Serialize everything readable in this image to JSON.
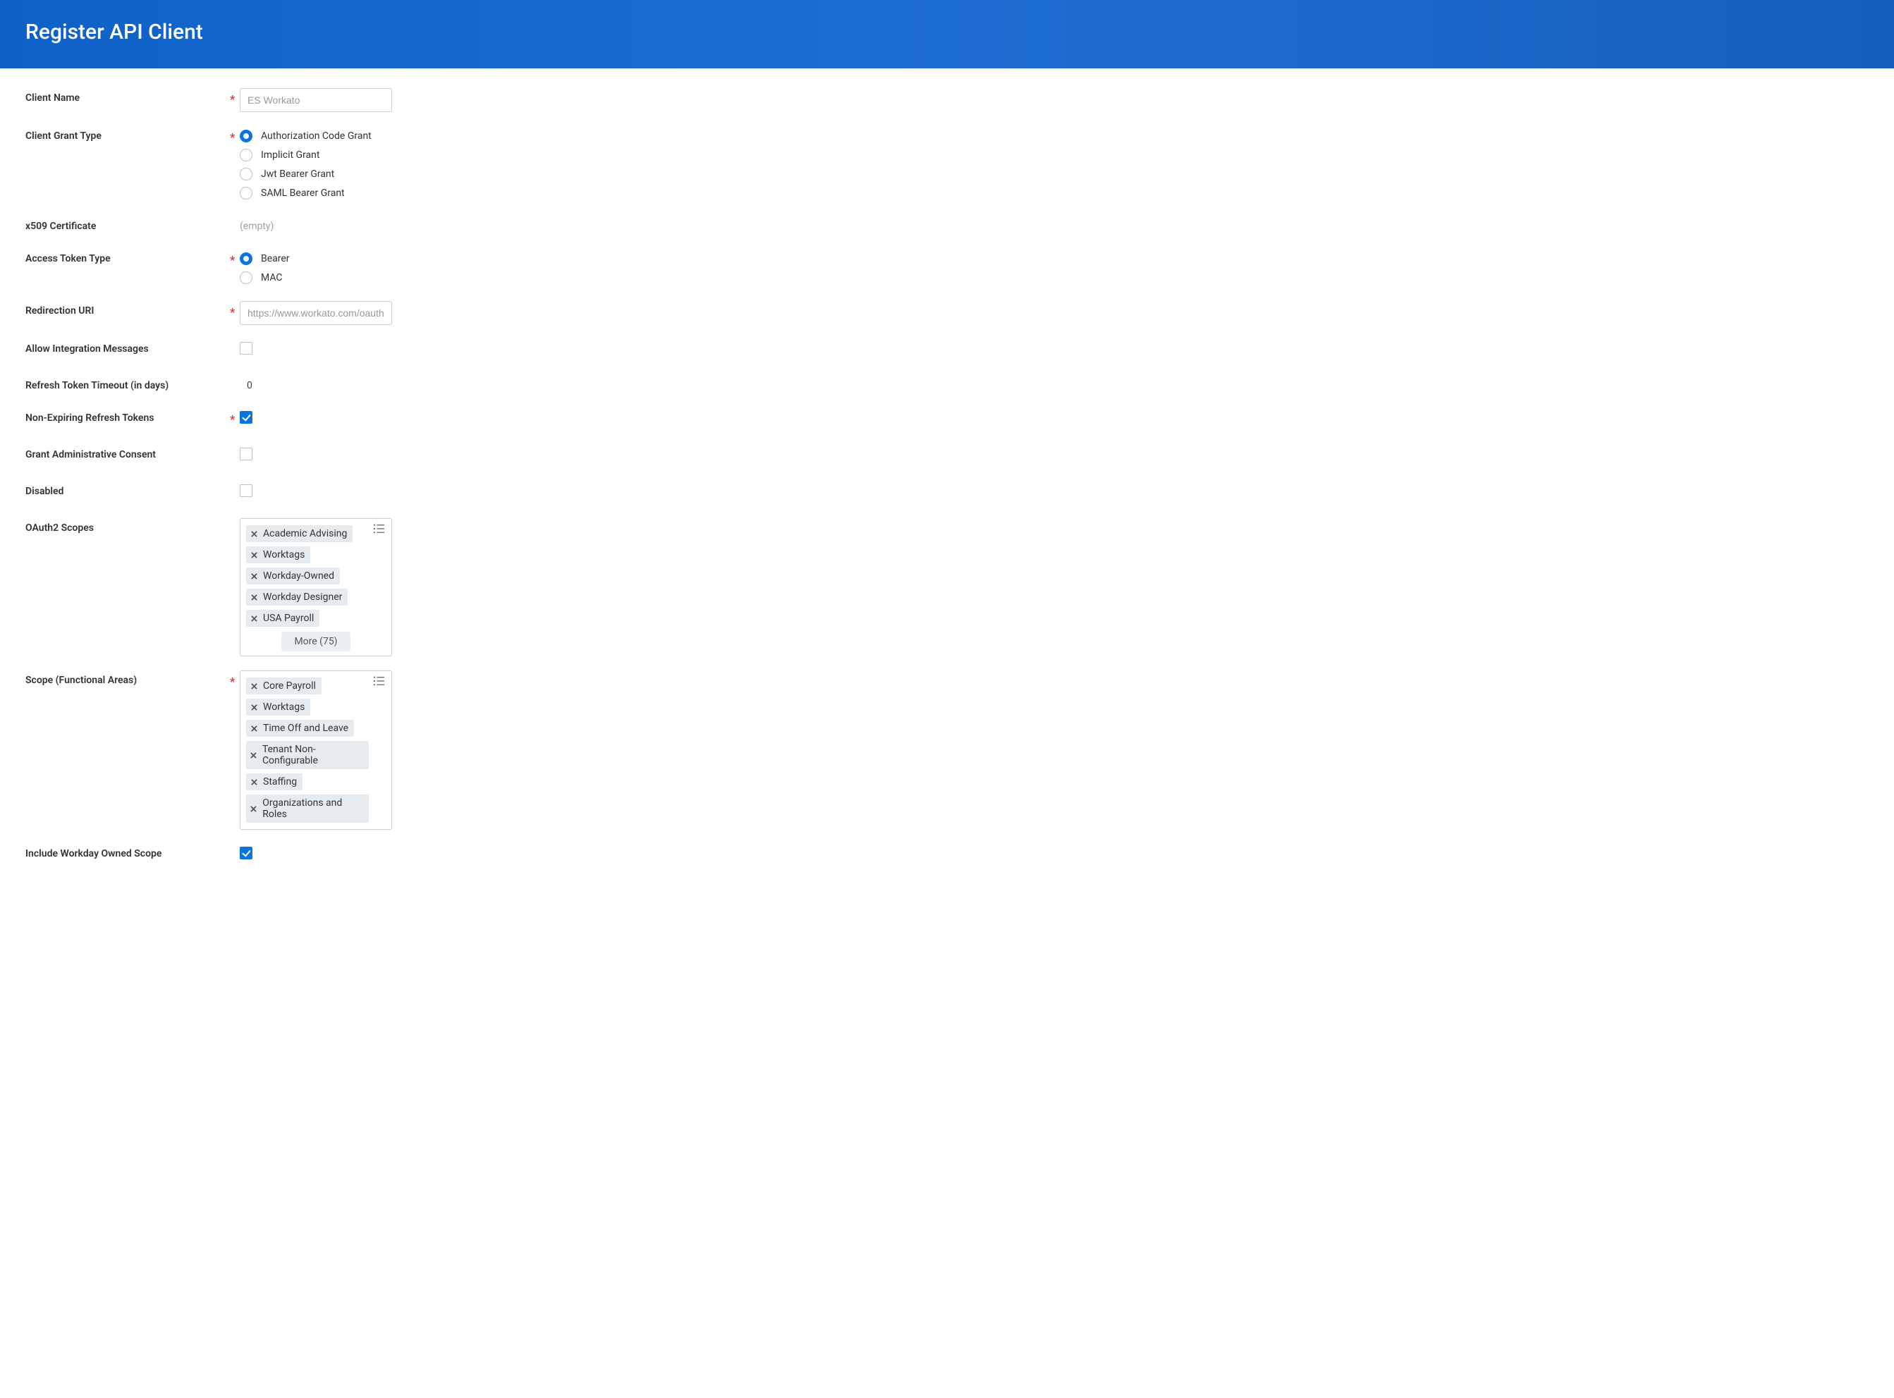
{
  "header": {
    "title": "Register API Client"
  },
  "labels": {
    "client_name": "Client Name",
    "client_grant_type": "Client Grant Type",
    "x509": "x509 Certificate",
    "access_token_type": "Access Token Type",
    "redirection_uri": "Redirection URI",
    "allow_integration": "Allow Integration Messages",
    "refresh_timeout": "Refresh Token Timeout (in days)",
    "non_expiring": "Non-Expiring Refresh Tokens",
    "grant_admin": "Grant Administrative Consent",
    "disabled": "Disabled",
    "oauth2_scopes": "OAuth2 Scopes",
    "scope_functional": "Scope (Functional Areas)",
    "include_owned": "Include Workday Owned Scope"
  },
  "values": {
    "client_name": "ES Workato",
    "x509": "(empty)",
    "redirection_uri": "https://www.workato.com/oauth/callba",
    "refresh_timeout": "0"
  },
  "grant_types": {
    "auth_code": "Authorization Code Grant",
    "implicit": "Implicit Grant",
    "jwt": "Jwt Bearer Grant",
    "saml": "SAML Bearer Grant"
  },
  "token_types": {
    "bearer": "Bearer",
    "mac": "MAC"
  },
  "oauth2scopes": {
    "s0": "Academic Advising",
    "s1": "Worktags",
    "s2": "Workday-Owned",
    "s3": "Workday Designer",
    "s4": "USA Payroll",
    "more": "More (75)"
  },
  "func_scopes": {
    "f0": "Core Payroll",
    "f1": "Worktags",
    "f2": "Time Off and Leave",
    "f3": "Tenant Non-Configurable",
    "f4": "Staffing",
    "f5": "Organizations and Roles"
  }
}
